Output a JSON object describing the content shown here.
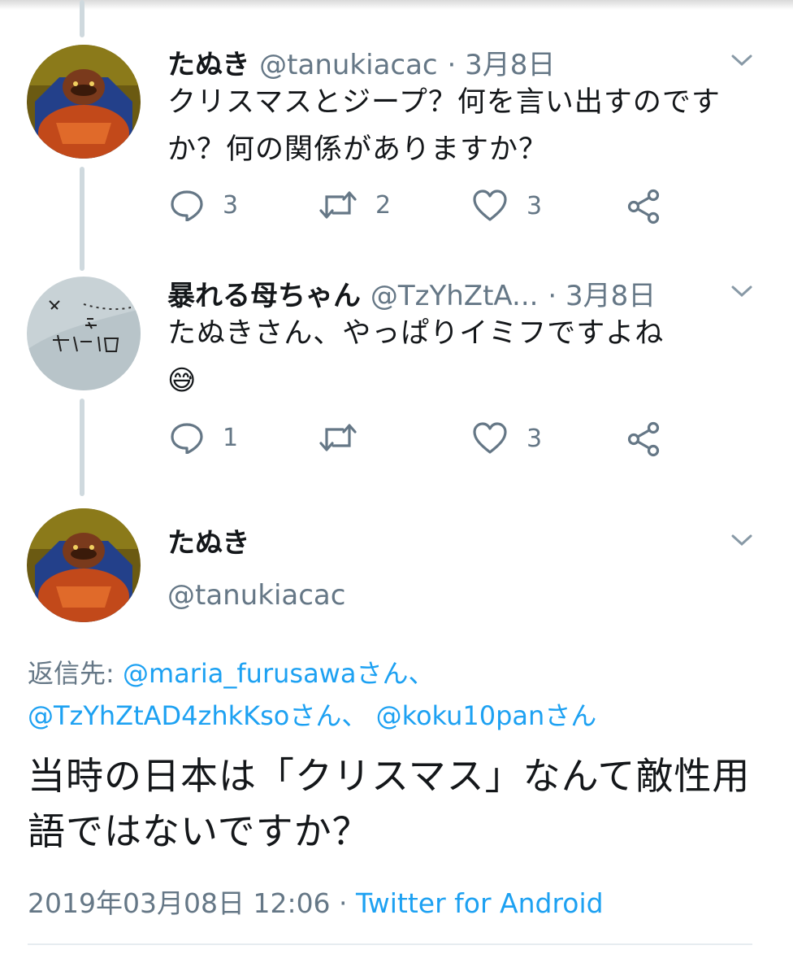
{
  "tweets": [
    {
      "name": "たぬき",
      "handle": "@tanukiacac",
      "date": "· 3月8日",
      "text": "クリスマスとジープ？何を言い出すのですか？何の関係がありますか？",
      "replies": "3",
      "retweets": "2",
      "likes": "3"
    },
    {
      "name": "暴れる母ちゃん",
      "handle": "@TzYhZtA...",
      "date": "· 3月8日",
      "text": "たぬきさん、やっぱりイミフですよね",
      "emoji": "😅",
      "replies": "1",
      "retweets": "",
      "likes": "3"
    }
  ],
  "main_tweet": {
    "name": "たぬき",
    "handle": "@tanukiacac",
    "reply_label": "返信先:",
    "mentions": [
      "@maria_furusawaさん、",
      "@TzYhZtAD4zhkKsoさん、",
      "@koku10panさん"
    ],
    "text": "当時の日本は「クリスマス」なんて敵性用語ではないですか？",
    "timestamp": "2019年03月08日 12:06 ·",
    "source": "Twitter for Android"
  },
  "colors": {
    "accent": "#1da1f2",
    "secondary_text": "#657786",
    "thread_line": "#cfd9de"
  },
  "icons": [
    "reply-icon",
    "retweet-icon",
    "like-icon",
    "share-icon",
    "chevron-down-icon"
  ]
}
